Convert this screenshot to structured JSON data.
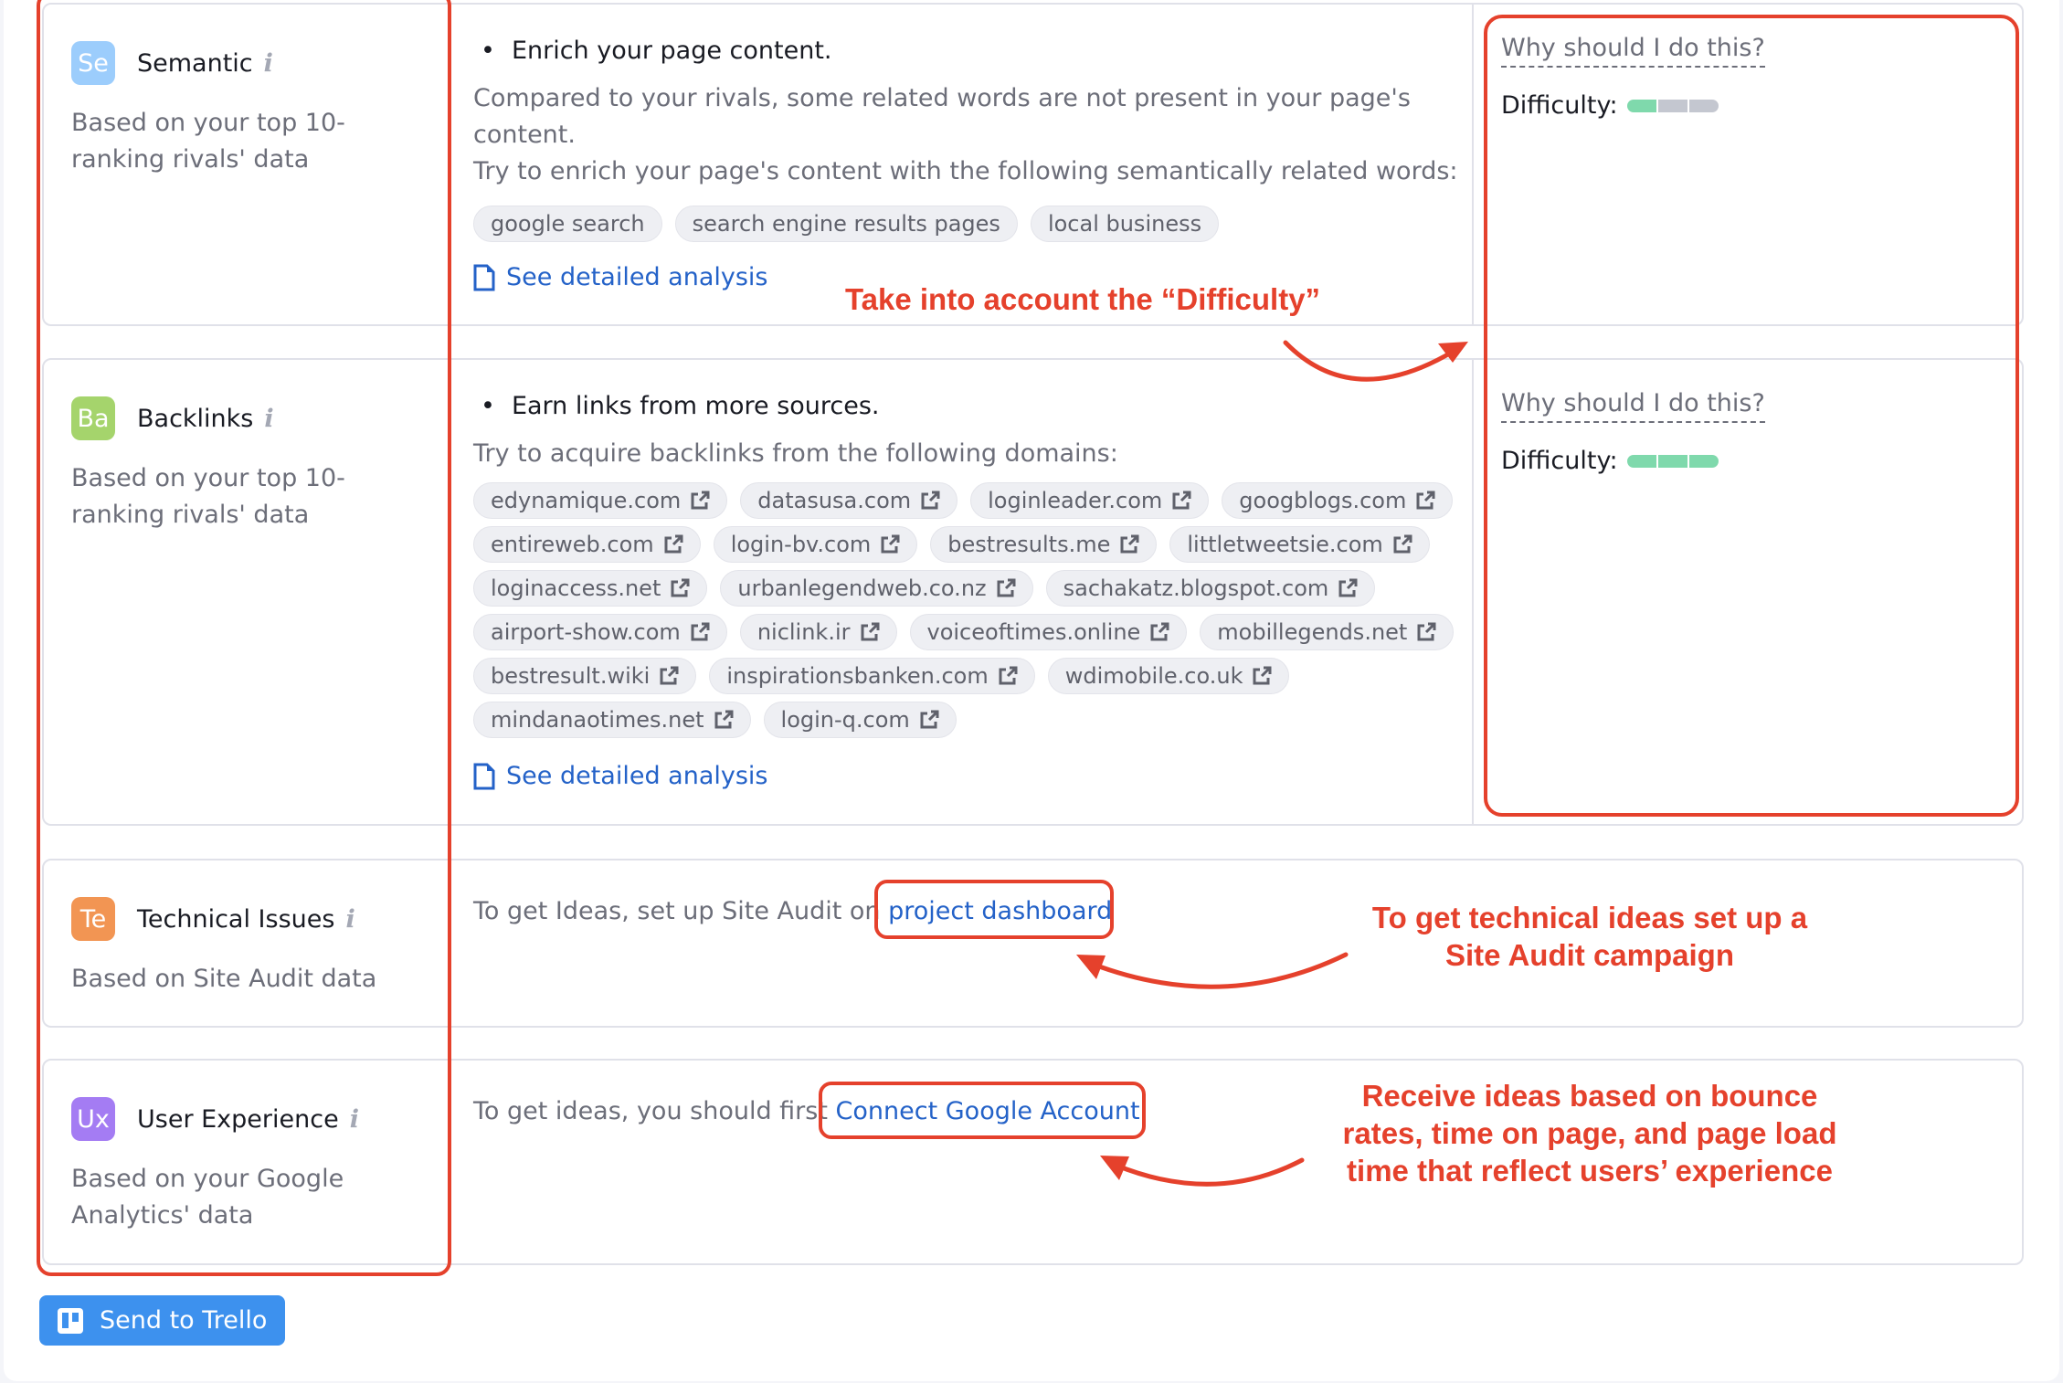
{
  "rows": [
    {
      "badge": "Se",
      "badge_color": "#9ccdfc",
      "title": "Semantic",
      "info_icon": "info-icon",
      "subtitle": "Based on your top 10-ranking rivals' data",
      "bullet": "Enrich your page content.",
      "paragraphs": [
        "Compared to your rivals, some related words are not present in your page's content.",
        "Try to enrich your page's content with the following semantically related words:"
      ],
      "chips": [
        "google search",
        "search engine results pages",
        "local business"
      ],
      "link": "See detailed analysis",
      "why": "Why should I do this?",
      "difficulty_label": "Difficulty:",
      "difficulty": {
        "filled": 1,
        "total": 3
      }
    },
    {
      "badge": "Ba",
      "badge_color": "#a5d46c",
      "title": "Backlinks",
      "info_icon": "info-icon",
      "subtitle": "Based on your top 10-ranking rivals' data",
      "bullet": "Earn links from more sources.",
      "paragraphs": [
        "Try to acquire backlinks from the following domains:"
      ],
      "chips": [
        "edynamique.com",
        "datasusa.com",
        "loginleader.com",
        "googblogs.com",
        "entireweb.com",
        "login-bv.com",
        "bestresults.me",
        "littletweetsie.com",
        "loginaccess.net",
        "urbanlegendweb.co.nz",
        "sachakatz.blogspot.com",
        "airport-show.com",
        "niclink.ir",
        "voiceoftimes.online",
        "mobillegends.net",
        "bestresult.wiki",
        "inspirationsbanken.com",
        "wdimobile.co.uk",
        "mindanaotimes.net",
        "login-q.com"
      ],
      "link": "See detailed analysis",
      "why": "Why should I do this?",
      "difficulty_label": "Difficulty:",
      "difficulty": {
        "filled": 3,
        "total": 3
      }
    },
    {
      "badge": "Te",
      "badge_color": "#f29553",
      "title": "Technical Issues",
      "info_icon": "info-icon",
      "subtitle": "Based on Site Audit data",
      "message": "To get Ideas, set up Site Audit on ",
      "message_link": "project dashboard"
    },
    {
      "badge": "Ux",
      "badge_color": "#a47cf3",
      "title": "User Experience",
      "info_icon": "info-icon",
      "subtitle": "Based on your Google Analytics' data",
      "message": "To get ideas, you should first ",
      "message_link": "Connect Google Account"
    }
  ],
  "colors": {
    "difficulty_filled": "#7fd9ac",
    "difficulty_empty": "#c4c7d0",
    "link": "#2462c8",
    "annotation": "#e5412c",
    "trello": "#3d91ee"
  },
  "annotations": {
    "difficulty": "Take into account the “Difficulty”",
    "technical": "To get technical ideas set up a Site Audit campaign",
    "ux": "Receive ideas based on bounce rates, time on page, and page load time that reflect users’ experience"
  },
  "footer": {
    "trello_button": "Send to Trello"
  }
}
